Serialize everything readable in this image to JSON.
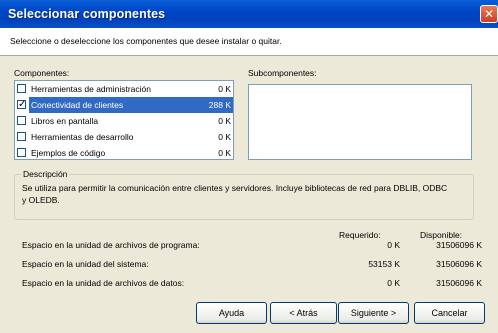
{
  "window": {
    "title": "Seleccionar componentes",
    "close_glyph": "✕"
  },
  "header": {
    "instruction": "Seleccione o deseleccione los componentes que desee instalar o quitar."
  },
  "components": {
    "label": "Componentes:",
    "items": [
      {
        "label": "Herramientas de administración",
        "size": "0 K",
        "checked": false,
        "selected": false
      },
      {
        "label": "Conectividad de clientes",
        "size": "288 K",
        "checked": true,
        "selected": true
      },
      {
        "label": "Libros en pantalla",
        "size": "0 K",
        "checked": false,
        "selected": false
      },
      {
        "label": "Herramientas de desarrollo",
        "size": "0 K",
        "checked": false,
        "selected": false
      },
      {
        "label": "Ejemplos de código",
        "size": "0 K",
        "checked": false,
        "selected": false
      }
    ]
  },
  "subcomponents": {
    "label": "Subcomponentes:"
  },
  "description": {
    "label": "Descripción",
    "text": "Se utiliza para permitir la comunicación entre clientes y servidores. Incluye bibliotecas de red para DBLIB, ODBC y OLEDB."
  },
  "space": {
    "required_label": "Requerido:",
    "available_label": "Disponible:",
    "rows": [
      {
        "label": "Espacio en la unidad de archivos de programa:",
        "required": "0 K",
        "available": "31506096 K"
      },
      {
        "label": "Espacio en la unidad del sistema:",
        "required": "53153 K",
        "available": "31506096 K"
      },
      {
        "label": "Espacio en la unidad de archivos de datos:",
        "required": "0 K",
        "available": "31506096 K"
      }
    ]
  },
  "buttons": {
    "help": "Ayuda",
    "back": "< Atrás",
    "next": "Siguiente >",
    "cancel": "Cancelar"
  }
}
